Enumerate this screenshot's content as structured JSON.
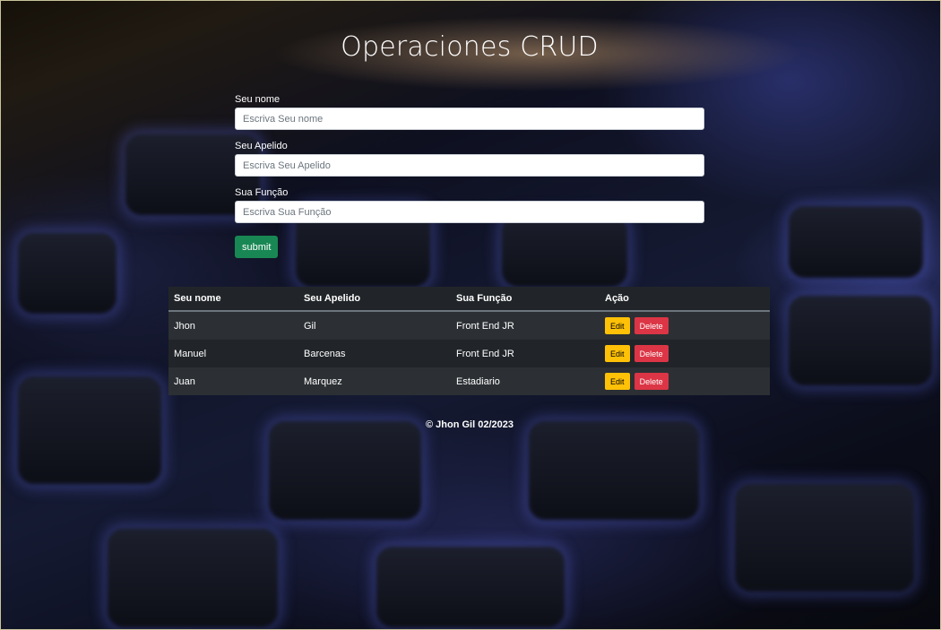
{
  "page": {
    "title": "Operaciones CRUD"
  },
  "form": {
    "fields": [
      {
        "label": "Seu nome",
        "placeholder": "Escriva Seu nome",
        "value": ""
      },
      {
        "label": "Seu Apelido",
        "placeholder": "Escriva Seu Apelido",
        "value": ""
      },
      {
        "label": "Sua Função",
        "placeholder": "Escriva Sua Função",
        "value": ""
      }
    ],
    "submit_label": "submit"
  },
  "table": {
    "headers": [
      "Seu nome",
      "Seu Apelido",
      "Sua Função",
      "Ação"
    ],
    "rows": [
      {
        "nome": "Jhon",
        "apelido": "Gil",
        "funcao": "Front End JR"
      },
      {
        "nome": "Manuel",
        "apelido": "Barcenas",
        "funcao": "Front End JR"
      },
      {
        "nome": "Juan",
        "apelido": "Marquez",
        "funcao": "Estadiario"
      }
    ],
    "edit_label": "Edit",
    "delete_label": "Delete"
  },
  "footer": {
    "text": "© Jhon Gil 02/2023"
  },
  "colors": {
    "submit": "#198754",
    "edit": "#ffc107",
    "delete": "#dc3545",
    "table_dark": "#212529"
  }
}
